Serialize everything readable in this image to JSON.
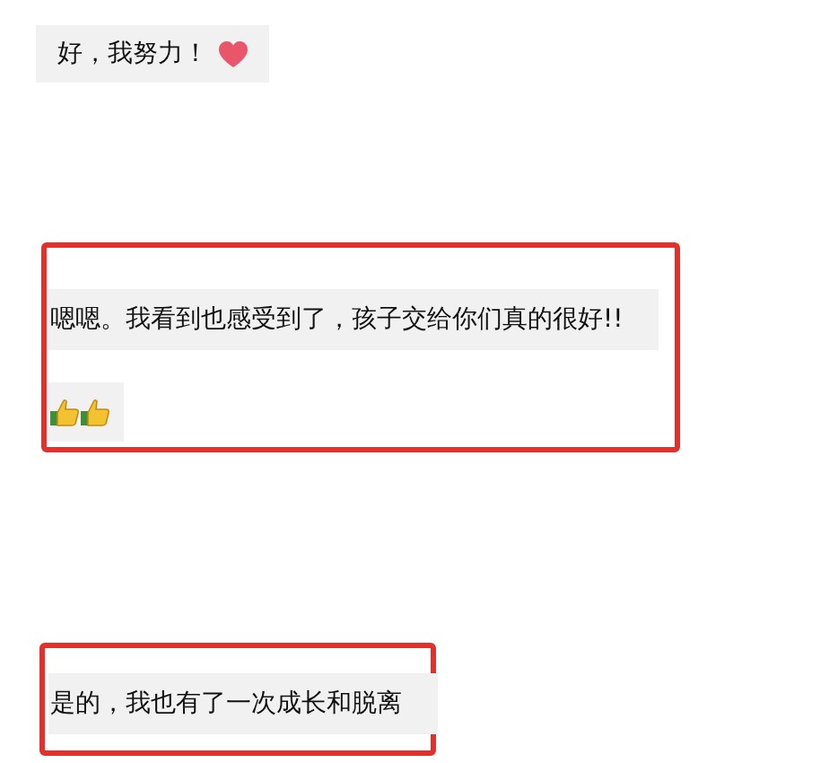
{
  "messages": [
    {
      "highlighted": false,
      "bubbles": [
        {
          "kind": "text-heart",
          "text": "好，我努力！"
        }
      ]
    },
    {
      "highlighted": true,
      "bubbles": [
        {
          "kind": "text",
          "text": "嗯嗯。我看到也感受到了，孩子交给你们真的很好!!"
        },
        {
          "kind": "thumbs"
        }
      ]
    },
    {
      "highlighted": true,
      "bubbles": [
        {
          "kind": "text",
          "text": "是的，我也有了一次成长和脱离"
        }
      ]
    }
  ]
}
